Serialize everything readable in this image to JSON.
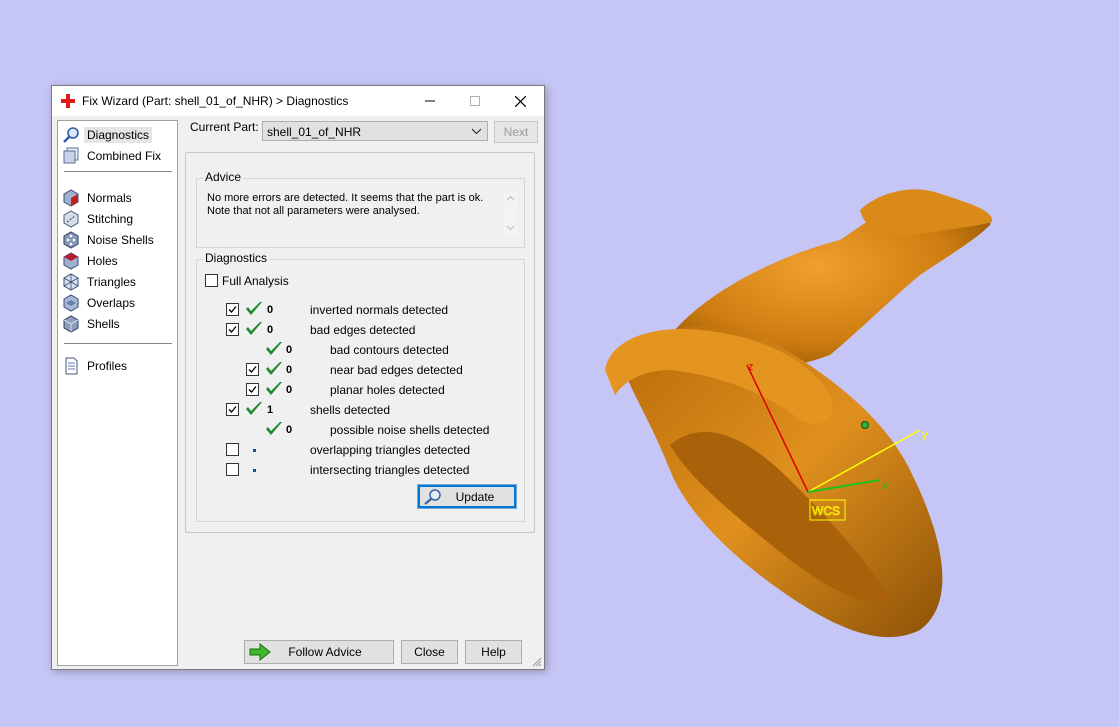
{
  "dialog": {
    "title": "Fix Wizard (Part: shell_01_of_NHR) > Diagnostics",
    "icon": "red-cross-icon"
  },
  "sidebar": {
    "items": [
      {
        "label": "Diagnostics",
        "icon": "magnifier-icon",
        "selected": true
      },
      {
        "label": "Combined Fix",
        "icon": "layers-icon"
      },
      {
        "label": "Normals",
        "icon": "cube-red-face-icon"
      },
      {
        "label": "Stitching",
        "icon": "stitch-icon"
      },
      {
        "label": "Noise Shells",
        "icon": "dice-icon"
      },
      {
        "label": "Holes",
        "icon": "hole-cube-icon"
      },
      {
        "label": "Triangles",
        "icon": "triangle-cube-icon"
      },
      {
        "label": "Overlaps",
        "icon": "overlap-cube-icon"
      },
      {
        "label": "Shells",
        "icon": "shell-cube-icon"
      },
      {
        "label": "Profiles",
        "icon": "document-icon"
      }
    ]
  },
  "current_part": {
    "label": "Current Part:",
    "value": "shell_01_of_NHR",
    "next_label": "Next"
  },
  "advice": {
    "legend": "Advice",
    "line1": "No more errors are detected. It seems that the part is ok.",
    "line2": "Note that not all parameters were analysed."
  },
  "diagnostics": {
    "legend": "Diagnostics",
    "full_analysis_label": "Full Analysis",
    "full_analysis_checked": false,
    "rows": [
      {
        "checkbox": true,
        "checked": true,
        "ok": true,
        "count": "0",
        "label": "inverted normals detected"
      },
      {
        "checkbox": true,
        "checked": true,
        "ok": true,
        "count": "0",
        "label": "bad edges detected"
      },
      {
        "checkbox": false,
        "ok": true,
        "count": "0",
        "label": "bad contours detected"
      },
      {
        "checkbox": true,
        "checked": true,
        "ok": true,
        "count": "0",
        "label": "near bad edges detected"
      },
      {
        "checkbox": true,
        "checked": true,
        "ok": true,
        "count": "0",
        "label": "planar holes detected"
      },
      {
        "checkbox": true,
        "checked": true,
        "ok": true,
        "count": "1",
        "label": "shells detected"
      },
      {
        "checkbox": false,
        "ok": true,
        "count": "0",
        "label": "possible noise shells detected"
      },
      {
        "checkbox": true,
        "checked": false,
        "ok": false,
        "count": "",
        "label": "overlapping triangles detected"
      },
      {
        "checkbox": true,
        "checked": false,
        "ok": false,
        "count": "",
        "label": "intersecting triangles detected"
      }
    ],
    "update_label": "Update"
  },
  "footer": {
    "follow_label": "Follow Advice",
    "close_label": "Close",
    "help_label": "Help"
  },
  "scene": {
    "background": "#c6c6f6",
    "model_color": "#d0800f",
    "wcs_label": "WCS",
    "axis_x": "x",
    "axis_y": "y",
    "axis_z": "z"
  }
}
